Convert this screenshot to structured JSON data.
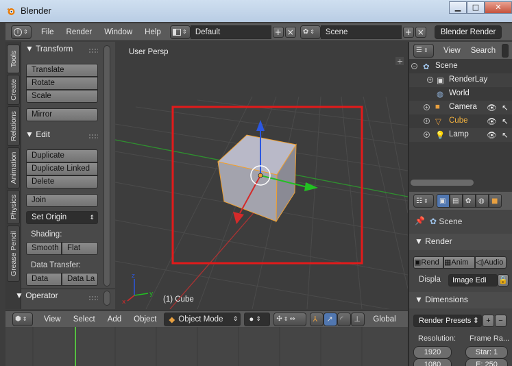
{
  "window": {
    "title": "Blender",
    "minimize": "▁",
    "maximize": "□",
    "close": "✕"
  },
  "info_header": {
    "menus": [
      "File",
      "Render",
      "Window",
      "Help"
    ],
    "screen_layout": "Default",
    "scene": "Scene",
    "render_engine": "Blender Render"
  },
  "left_tabs": [
    "Tools",
    "Create",
    "Relations",
    "Animation",
    "Physics",
    "Grease Pencil"
  ],
  "tool_shelf": {
    "transform_title": "Transform",
    "transform_buttons": [
      "Translate",
      "Rotate",
      "Scale"
    ],
    "mirror": "Mirror",
    "edit_title": "Edit",
    "edit_buttons": [
      "Duplicate",
      "Duplicate Linked",
      "Delete"
    ],
    "join": "Join",
    "set_origin": "Set Origin",
    "shading_label": "Shading:",
    "smooth": "Smooth",
    "flat": "Flat",
    "data_transfer_label": "Data Transfer:",
    "data": "Data",
    "data_la": "Data La",
    "operator_title": "Operator"
  },
  "viewport": {
    "view_label": "User Persp",
    "object_label": "(1) Cube",
    "colors": {
      "highlight_box": "#e21a1a",
      "x_axis": "#d42a2a",
      "y_axis": "#22c022",
      "z_axis": "#2b57e0",
      "grid": "#4a4a4a"
    }
  },
  "viewport_header": {
    "menus": [
      "View",
      "Select",
      "Add",
      "Object"
    ],
    "mode": "Object Mode",
    "orientation": "Global"
  },
  "outliner": {
    "menus": [
      "View",
      "Search"
    ],
    "items": [
      {
        "label": "Scene",
        "icon": "scene-icon"
      },
      {
        "label": "RenderLay",
        "icon": "renderlayer-icon"
      },
      {
        "label": "World",
        "icon": "world-icon"
      },
      {
        "label": "Camera",
        "icon": "camera-icon"
      },
      {
        "label": "Cube",
        "icon": "mesh-icon"
      },
      {
        "label": "Lamp",
        "icon": "lamp-icon"
      }
    ]
  },
  "properties": {
    "context": "Scene",
    "render_title": "Render",
    "render_buttons": [
      "Rend",
      "Anim",
      "Audio"
    ],
    "display_label": "Displa",
    "display_value": "Image Edi",
    "dimensions_title": "Dimensions",
    "render_presets": "Render Presets",
    "resolution_label": "Resolution:",
    "frame_range_label": "Frame Ra...",
    "res_x": "1920",
    "res_y": "1080",
    "start": "Star: 1",
    "end": "E: 250"
  }
}
